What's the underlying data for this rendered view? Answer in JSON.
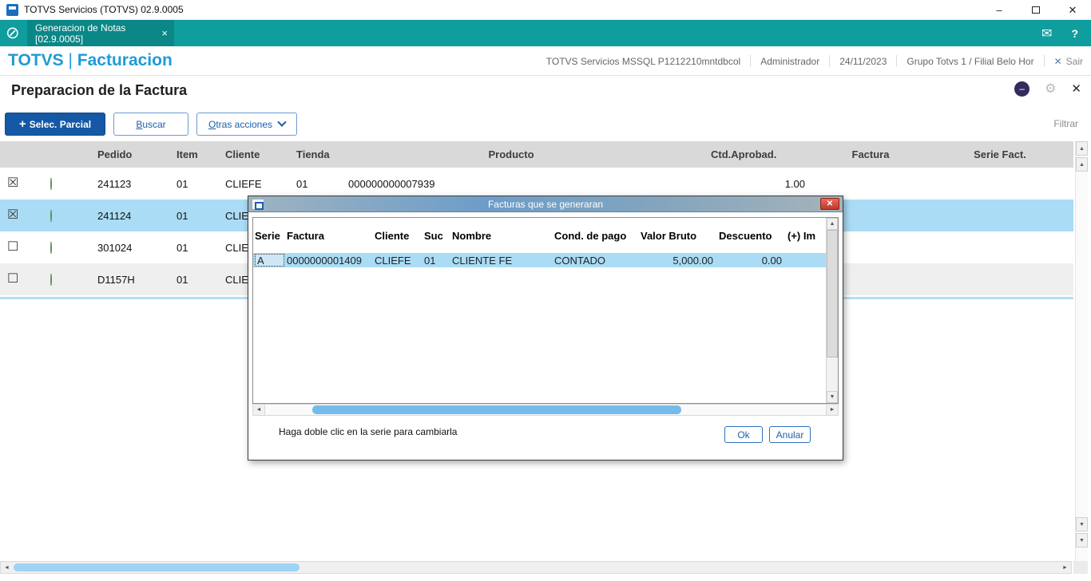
{
  "window": {
    "title": "TOTVS Servicios (TOTVS) 02.9.0005"
  },
  "tabbar": {
    "tab_label": "Generacion de Notas [02.9.0005]",
    "tab_close": "×"
  },
  "header": {
    "brand": "TOTVS",
    "divider": "| ",
    "module": "Facturacion",
    "environment": "TOTVS Servicios MSSQL P1212210mntdbcol",
    "user": "Administrador",
    "date": "24/11/2023",
    "branch": "Grupo Totvs 1 / Filial Belo Hor",
    "exit_label": "Sair"
  },
  "page": {
    "title": "Preparacion de la Factura"
  },
  "toolbar": {
    "plus": "+",
    "select_partial": "Selec. Parcial",
    "search": "Buscar",
    "other_actions": "Otras acciones",
    "filter": "Filtrar"
  },
  "grid": {
    "columns": {
      "pedido": "Pedido",
      "item": "Item",
      "cliente": "Cliente",
      "tienda": "Tienda",
      "producto": "Producto",
      "ctd": "Ctd.Aprobad.",
      "factura": "Factura",
      "serie": "Serie Fact."
    },
    "rows": [
      {
        "pedido": "241123",
        "item": "01",
        "cliente": "CLIEFE",
        "tienda": "01",
        "producto": "000000000007939",
        "ctd": "1.00",
        "factura": "",
        "serie": ""
      },
      {
        "pedido": "241124",
        "item": "01",
        "cliente": "CLIEFE",
        "tienda": "",
        "producto": "",
        "ctd": "",
        "factura": "",
        "serie": ""
      },
      {
        "pedido": "301024",
        "item": "01",
        "cliente": "CLIEFE",
        "tienda": "",
        "producto": "",
        "ctd": "",
        "factura": "",
        "serie": ""
      },
      {
        "pedido": "D1157H",
        "item": "01",
        "cliente": "CLIEFE",
        "tienda": "",
        "producto": "",
        "ctd": "",
        "factura": "",
        "serie": ""
      }
    ]
  },
  "dialog": {
    "title": "Facturas que se generaran",
    "columns": {
      "serie": "Serie",
      "factura": "Factura",
      "cliente": "Cliente",
      "suc": "Suc",
      "nombre": "Nombre",
      "cond": "Cond. de pago",
      "valor": "Valor Bruto",
      "descuento": "Descuento",
      "impuesto": "(+) Im"
    },
    "row": {
      "serie": "A",
      "factura": "0000000001409",
      "cliente": "CLIEFE",
      "suc": "01",
      "nombre": "CLIENTE FE",
      "cond": "CONTADO",
      "valor": "5,000.00",
      "descuento": "0.00"
    },
    "hint": "Haga doble clic en la serie para cambiarla",
    "ok_label": "Ok",
    "cancel_label": "Anular"
  },
  "icons": {
    "logo": "⊘",
    "mail": "✉",
    "help": "?",
    "minimize": "–",
    "close": "✕",
    "assistant": "–",
    "gear": "⚙",
    "exit_x": "✕",
    "dialog_close": "✕",
    "checkbox_checked": "☒",
    "checkbox_unchecked": "☐",
    "up": "▲",
    "down": "▼",
    "left": "◄",
    "right": "►"
  },
  "colors": {
    "teal": "#0f9d9d",
    "brand_blue": "#1e9bd7",
    "primary_button": "#1558a5",
    "selection": "#aadcf5",
    "header_gray": "#d9d9d9",
    "scroll_thumb_blue": "#9fd3f2"
  }
}
